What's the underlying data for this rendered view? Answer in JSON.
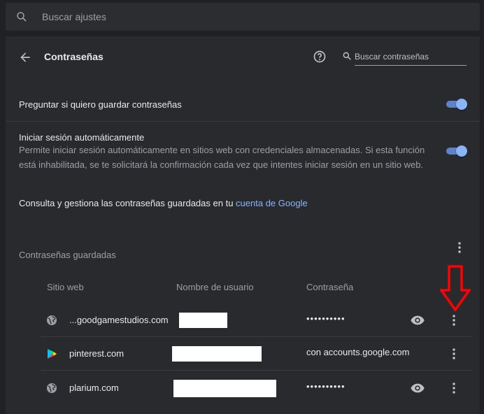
{
  "top_search": {
    "placeholder": "Buscar ajustes",
    "icon": "search-icon"
  },
  "header": {
    "title": "Contraseñas",
    "search_placeholder": "Buscar contraseñas"
  },
  "settings": {
    "offer_save": {
      "label": "Preguntar si quiero guardar contraseñas",
      "enabled": true
    },
    "auto_signin": {
      "label": "Iniciar sesión automáticamente",
      "description_line1": "Permite iniciar sesión automáticamente en sitios web con credenciales almacenadas. Si esta función",
      "description_line2": "está inhabilitada, se te solicitará la confirmación cada vez que intentes iniciar sesión en un sitio web.",
      "enabled": true
    },
    "manage": {
      "text": "Consulta y gestiona las contraseñas guardadas en tu ",
      "link": "cuenta de Google"
    }
  },
  "saved": {
    "title": "Contraseñas guardadas",
    "columns": {
      "site": "Sitio web",
      "user": "Nombre de usuario",
      "password": "Contraseña"
    },
    "rows": [
      {
        "site": "...goodgamestudios.com",
        "icon": "globe-icon",
        "password": "••••••••••",
        "has_eye": true
      },
      {
        "site": "pinterest.com",
        "icon": "play-store-icon",
        "password": "con accounts.google.com",
        "has_eye": false
      },
      {
        "site": "plarium.com",
        "icon": "globe-icon",
        "password": "••••••••••",
        "has_eye": true
      }
    ]
  },
  "colors": {
    "accent": "#8ab4f8",
    "annotation": "#ff0000",
    "background": "#292a2d"
  }
}
